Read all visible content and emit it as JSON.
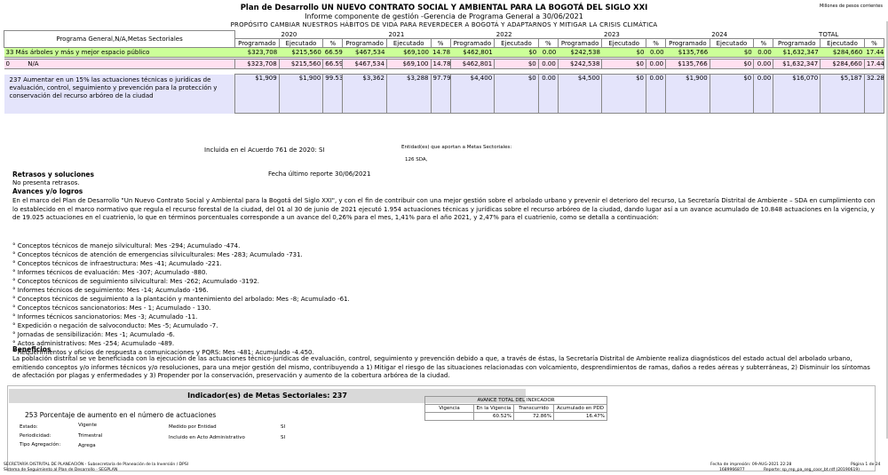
{
  "header": {
    "title": "Plan de Desarrollo UN NUEVO CONTRATO SOCIAL Y AMBIENTAL PARA LA BOGOTÁ DEL SIGLO XXI",
    "subtitle": "Informe componente de gestión -Gerencia de Programa General a 30/06/2021",
    "purpose": "PROPÓSITO CAMBIAR NUESTROS HÁBITOS DE VIDA PARA REVERDECER A BOGOTÁ Y ADAPTARNOS Y MITIGAR LA CRISIS CLIMÁTICA",
    "units": "Millones de pesos corrientes"
  },
  "table": {
    "row_label_header": "Programa General,N/A,Metas Sectoriales",
    "years": [
      "2020",
      "2021",
      "2022",
      "2023",
      "2024",
      "TOTAL"
    ],
    "subcols": [
      "Programado",
      "Ejecutado",
      "%"
    ],
    "rows": [
      {
        "label": "33  Más árboles y más y mejor espacio público",
        "values": [
          "$323,708",
          "$215,560",
          "66.59",
          "$467,534",
          "$69,100",
          "14.78",
          "$462,801",
          "$0",
          "0.00",
          "$242,538",
          "$0",
          "0.00",
          "$135,766",
          "$0",
          "0.00",
          "$1,632,347",
          "$284,660",
          "17.44"
        ]
      },
      {
        "label": "0",
        "label2": "N/A",
        "values": [
          "$323,708",
          "$215,560",
          "66.59",
          "$467,534",
          "$69,100",
          "14.78",
          "$462,801",
          "$0",
          "0.00",
          "$242,538",
          "$0",
          "0.00",
          "$135,766",
          "$0",
          "0.00",
          "$1,632,347",
          "$284,660",
          "17.44"
        ]
      },
      {
        "label": "237 Aumentar en un 15%  las actuaciones técnicas o jurídicas de evaluación, control, seguimiento y prevención para la protección y conservación del recurso arbóreo de la ciudad",
        "values": [
          "$1,909",
          "$1,900",
          "99.53",
          "$3,362",
          "$3,288",
          "97.79",
          "$4,400",
          "$0",
          "0.00",
          "$4,500",
          "$0",
          "0.00",
          "$1,900",
          "$0",
          "0.00",
          "$16,070",
          "$5,187",
          "32.28"
        ]
      }
    ]
  },
  "meta": {
    "acuerdo": "Incluida en el Acuerdo 761 de 2020: SI",
    "entidades_label": "Entidad(es) que aportan a Metas Sectoriales:",
    "entidad": "126 SDA,",
    "retrasos_title": "Retrasos y soluciones",
    "fecha_reporte": "Fecha último reporte 30/06/2021",
    "retrasos_text": "No presenta retrasos.",
    "avances_title": "Avances y/o logros",
    "avances_text": "En el marco del Plan de Desarrollo \"Un Nuevo Contrato Social y Ambiental para la Bogotá del Siglo XXI\", y con el fin de contribuir con una mejor gestión sobre el arbolado urbano y prevenir el deterioro del recurso, La Secretaría Distrital de Ambiente – SDA en cumplimiento con lo establecido en el marco normativo que regula el recurso forestal de la ciudad, del 01 al 30 de junio de 2021 ejecutó 1.954 actuaciones técnicas y jurídicas sobre el recurso arbóreo de la ciudad, dando lugar así a un avance acumulado de 10.848 actuaciones en la vigencia, y de 19.025 actuaciones en el cuatrienio, lo que en términos porcentuales corresponde a un avance del 0,26% para el mes, 1,41% para el año 2021, y 2,47% para el cuatrienio, como se detalla a continuación:",
    "bullets": [
      "° Conceptos técnicos de manejo silvicultural:  Mes -294; Acumulado -474.",
      "° Conceptos técnicos de atención de emergencias silviculturales:  Mes -283; Acumulado -731.",
      "° Conceptos técnicos de infraestructura:  Mes -41; Acumulado -221.",
      "° Informes técnicos de evaluación:  Mes -307; Acumulado -880.",
      "° Conceptos técnicos de seguimiento silvicultural:  Mes -262; Acumulado -3192.",
      "° Informes técnicos de seguimiento:  Mes -14; Acumulado -196.",
      "° Conceptos técnicos de seguimiento a la plantación y mantenimiento del arbolado:  Mes -8; Acumulado -61.",
      "° Conceptos técnicos sancionatorios:  Mes - 1; Acumulado - 130.",
      "° Informes técnicos sancionatorios:  Mes -3; Acumulado -11.",
      "° Expedición o negación de salvoconducto:  Mes -5; Acumulado -7.",
      "° Jornadas de sensibilización:  Mes -1; Acumulado -6.",
      "° Actos administrativos:  Mes -254; Acumulado -489.",
      "° Requerimientos y oficios de respuesta a comunicaciones y PQRS:  Mes -481; Acumulado -4.450."
    ],
    "beneficios_title": "Beneficios",
    "beneficios_text": "La población distrital se ve beneficiada con la ejecución de las actuaciones técnico-jurídicas de evaluación, control, seguimiento y prevención debido a que, a través de éstas, la Secretaría Distrital de Ambiente realiza diagnósticos del estado actual del arbolado urbano, emitiendo conceptos y/o informes técnicos y/o resoluciones, para una mejor gestión del mismo, contribuyendo a 1) Mitigar el riesgo de las situaciones relacionadas con volcamiento, desprendimientos de ramas,  daños a redes aéreas y subterráneas, 2) Disminuir los síntomas de afectación por plagas y enfermedades y 3) Propender por la conservación, preservación y aumento de la cobertura arbórea de la ciudad."
  },
  "indicador": {
    "title": "Indicador(es) de Metas Sectoriales: 237",
    "name": "253  Porcentaje de aumento en el número de actuaciones",
    "estado_label": "Estado:",
    "estado": "Vigente",
    "periodicidad_label": "Periodicidad:",
    "periodicidad": "Trimestral",
    "tipo_label": "Tipo Agregación:",
    "tipo": "Agrega",
    "medido_label": "Medido por Entidad",
    "medido": "SI",
    "incluido_label": "Incluido en Acto Administrativo",
    "incluido": "SI",
    "avance": {
      "title": "AVANCE TOTAL DEL INDICADOR",
      "headers": [
        "Vigencia",
        "En la Vigencia",
        "Transcurrido",
        "Acumulado en PDD"
      ],
      "values": [
        "",
        "60.52%",
        "72.86%",
        "16.47%"
      ]
    }
  },
  "footer": {
    "left1": "SECRETARÍA DISTRITAL DE PLANEACIÓN - Subsecretaría de Planeación de la Inversión / DPSI",
    "left2": "Sistema de Seguimiento al Plan de Desarrollo - SEGPLAN",
    "right1": "Fecha de impresión: 09-AUG-2021 22:28",
    "page": "Página  1 de 24",
    "right2": "1689966877",
    "report": "Reporte: sp_rep_pa_seg_coor_bt.rdf (20190619)"
  }
}
